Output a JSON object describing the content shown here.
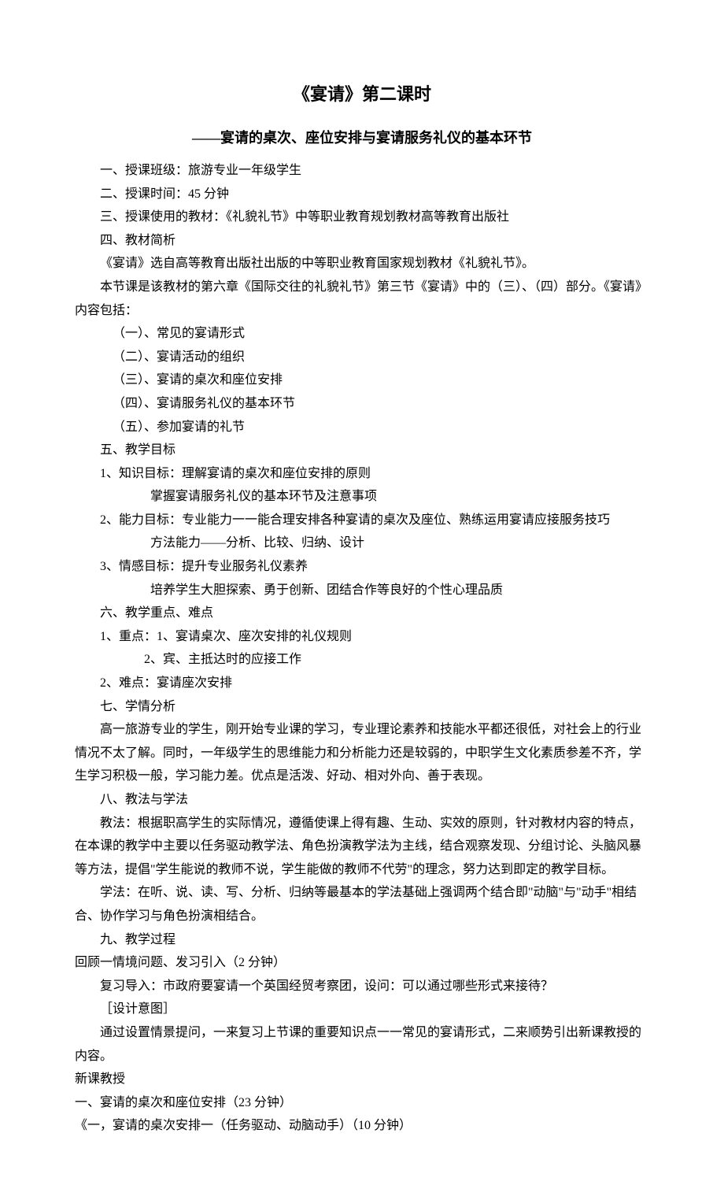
{
  "title": "《宴请》第二课时",
  "subtitle": "——宴请的桌次、座位安排与宴请服务礼仪的基本环节",
  "lines": {
    "l1": "一、授课班级：旅游专业一年级学生",
    "l2": "二、授课时间：45 分钟",
    "l3": "三、授课使用的教材：《礼貌礼节》中等职业教育规划教材高等教育出版社",
    "l4": "四、教材简析",
    "l5": "《宴请》选自高等教育出版社出版的中等职业教育国家规划教材《礼貌礼节》。",
    "l6": "本节课是该教材的第六章《国际交往的礼貌礼节》第三节《宴请》中的（三）、（四）部分。《宴请》内容包括：",
    "l7": "（一）、常见的宴请形式",
    "l8": "（二）、宴请活动的组织",
    "l9": "（三）、宴请的桌次和座位安排",
    "l10": "（四）、宴请服务礼仪的基本环节",
    "l11": "（五）、参加宴请的礼节",
    "l12": "五、教学目标",
    "l13": "1、知识目标：理解宴请的桌次和座位安排的原则",
    "l14": "掌握宴请服务礼仪的基本环节及注意事项",
    "l15": "2、能力目标：专业能力一一能合理安排各种宴请的桌次及座位、熟练运用宴请应接服务技巧",
    "l16": "方法能力——分析、比较、归纳、设计",
    "l17": "3、情感目标：提升专业服务礼仪素养",
    "l18": "培养学生大胆探索、勇于创新、团结合作等良好的个性心理品质",
    "l19": "六、教学重点、难点",
    "l20": "1、重点：1、宴请桌次、座次安排的礼仪规则",
    "l21": "2、宾、主抵达时的应接工作",
    "l22": "2、难点：宴请座次安排",
    "l23": "七、学情分析",
    "l24": "高一旅游专业的学生，刚开始专业课的学习，专业理论素养和技能水平都还很低，对社会上的行业情况不太了解。同时，一年级学生的思维能力和分析能力还是较弱的，中职学生文化素质参差不齐，学生学习积极一般，学习能力差。优点是活泼、好动、相对外向、善于表现。",
    "l25": "八、教法与学法",
    "l26": "教法：根据职高学生的实际情况，遵循使课上得有趣、生动、实效的原则，针对教材内容的特点，在本课的教学中主要以任务驱动教学法、角色扮演教学法为主线，结合观察发现、分组讨论、头脑风暴等方法，提倡\"学生能说的教师不说，学生能做的教师不代劳\"的理念，努力达到即定的教学目标。",
    "l27": "学法：在听、说、读、写、分析、归纳等最基本的学法基础上强调两个结合即\"动脑\"与\"动手\"相结合、协作学习与角色扮演相结合。",
    "l28": "九、教学过程",
    "l29": "回顾一情境问题、发习引入（2 分钟）",
    "l30": "复习导入：市政府要宴请一个英国经贸考察团，设问：可以通过哪些形式来接待？",
    "l31": "［设计意图］",
    "l32": "通过设置情景提问，一来复习上节课的重要知识点一一常见的宴请形式，二来顺势引出新课教授的内容。",
    "l33": "新课教授",
    "l34": "一、宴请的桌次和座位安排（23 分钟）",
    "l35": "《一，宴请的桌次安排一（任务驱动、动脑动手）（10 分钟）"
  }
}
